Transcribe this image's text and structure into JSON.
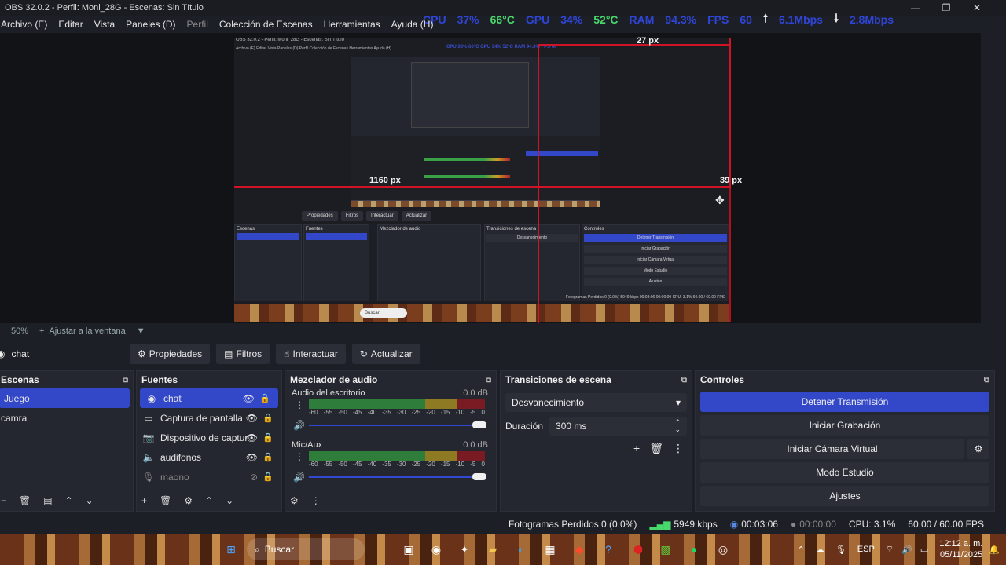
{
  "window": {
    "title": "OBS 32.0.2 - Perfil: Moni_28G - Escenas: Sin Título",
    "minimize": "—",
    "maximize": "❐",
    "close": "✕"
  },
  "stats": {
    "cpu_label": "CPU",
    "cpu_value": "37%",
    "cpu_temp": "66°C",
    "gpu_label": "GPU",
    "gpu_value": "34%",
    "gpu_temp": "52°C",
    "ram_label": "RAM",
    "ram_value": "94.3%",
    "fps_label": "FPS",
    "fps_value": "60",
    "upload": "6.1Mbps",
    "download": "2.8Mbps"
  },
  "menu": [
    "Archivo (E)",
    "Editar",
    "Vista",
    "Paneles (D)",
    "Perfil",
    "Colección de Escenas",
    "Herramientas",
    "Ayuda (H)"
  ],
  "preview": {
    "measure_top": "27 px",
    "measure_right": "39 px",
    "measure_left": "1160 px",
    "nested_title": "OBS 32.0.2 - Perfil: Moni_28G - Escenas: Sin Título",
    "nested_menu": "Archivo (E)  Editar  Vista  Paneles (D)  Perfil  Colección de Escenas  Herramientas  Ayuda (H)",
    "nested_stats": "CPU 33%  66°C  GPU 34%  52°C  RAM 94.3%  FPS 60",
    "nested_buttons": [
      "Propiedades",
      "Filtros",
      "Interactuar",
      "Actualizar"
    ],
    "nested_controls": [
      "Detener Transmisión",
      "Iniciar Grabación",
      "Iniciar Cámara Virtual",
      "Modo Estudio",
      "Ajustes"
    ],
    "nested_status": "Fotogramas Perdidos 0 (0.0%)  5949 kbps  00:03:06  00:00:00  CPU: 3.1%  60.00 / 60.00 FPS",
    "nested_search": "Buscar"
  },
  "zoom": {
    "level": "50%",
    "fit": "Ajustar a la ventana"
  },
  "source_toolbar": {
    "selected_source": "chat",
    "buttons": [
      "Propiedades",
      "Filtros",
      "Interactuar",
      "Actualizar"
    ]
  },
  "scenes": {
    "title": "Escenas",
    "items": [
      "Juego",
      "camra"
    ]
  },
  "sources": {
    "title": "Fuentes",
    "items": [
      "chat",
      "Captura de pantalla",
      "Dispositivo de captura",
      "audifonos",
      "maono"
    ]
  },
  "mixer": {
    "title": "Mezclador de audio",
    "tracks": [
      {
        "name": "Audio del escritorio",
        "db": "0.0 dB"
      },
      {
        "name": "Mic/Aux",
        "db": "0.0 dB"
      }
    ],
    "scale": [
      "-60",
      "-55",
      "-50",
      "-45",
      "-40",
      "-35",
      "-30",
      "-25",
      "-20",
      "-15",
      "-10",
      "-5",
      "0"
    ]
  },
  "transitions": {
    "title": "Transiciones de escena",
    "selected": "Desvanecimiento",
    "duration_label": "Duración",
    "duration_value": "300 ms"
  },
  "controls": {
    "title": "Controles",
    "stop_stream": "Detener Transmisión",
    "start_record": "Iniciar Grabación",
    "start_vcam": "Iniciar Cámara Virtual",
    "studio_mode": "Modo Estudio",
    "settings": "Ajustes"
  },
  "status": {
    "dropped": "Fotogramas Perdidos 0 (0.0%)",
    "bitrate": "5949 kbps",
    "stream_time": "00:03:06",
    "record_time": "00:00:00",
    "cpu": "CPU: 3.1%",
    "fps": "60.00 / 60.00 FPS"
  },
  "taskbar": {
    "search": "Buscar",
    "lang": "ESP",
    "time": "12:12 a. m.",
    "date": "05/11/2025"
  },
  "colors": {
    "accent": "#3347c9",
    "measure_red": "#d11425",
    "stat_blue": "#2f45d8",
    "stat_green": "#49d86c"
  }
}
